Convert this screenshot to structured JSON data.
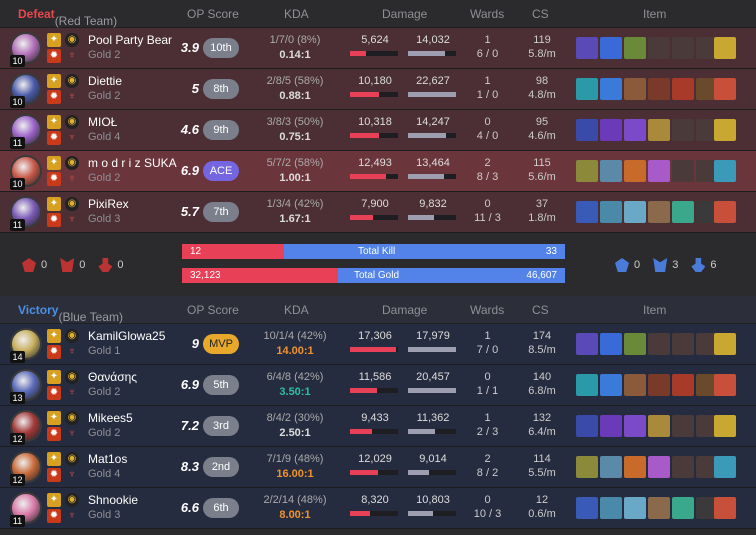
{
  "red": {
    "result": "Defeat",
    "team": "(Red Team)",
    "cols": {
      "op": "OP Score",
      "kda": "KDA",
      "damage": "Damage",
      "wards": "Wards",
      "cs": "CS",
      "item": "Item"
    },
    "players": [
      {
        "name": "Pool Party Bear",
        "tier": "Gold 2",
        "level": "10",
        "score": "3.9",
        "rank": "10th",
        "kda": "1/7/0 (8%)",
        "ratio": "0.14:1",
        "dealt": "5,624",
        "taken": "14,032",
        "dealt_frac": 0.33,
        "taken_frac": 0.78,
        "wards": "1",
        "wards2": "6 / 0",
        "cs": "119",
        "csm": "5.8/m",
        "champ": "#b26fb8",
        "h": false
      },
      {
        "name": "Diettie",
        "tier": "Gold 2",
        "level": "10",
        "score": "5",
        "rank": "8th",
        "kda": "2/8/5 (58%)",
        "ratio": "0.88:1",
        "dealt": "10,180",
        "taken": "22,627",
        "dealt_frac": 0.6,
        "taken_frac": 1.0,
        "wards": "1",
        "wards2": "1 / 0",
        "cs": "98",
        "csm": "4.8/m",
        "champ": "#4a5aa8",
        "h": false
      },
      {
        "name": "MIOŁ",
        "tier": "Gold 4",
        "level": "11",
        "score": "4.6",
        "rank": "9th",
        "kda": "3/8/3 (50%)",
        "ratio": "0.75:1",
        "dealt": "10,318",
        "taken": "14,247",
        "dealt_frac": 0.61,
        "taken_frac": 0.79,
        "wards": "0",
        "wards2": "4 / 0",
        "cs": "95",
        "csm": "4.6/m",
        "champ": "#9c63c8",
        "h": false
      },
      {
        "name": "m o d r i z SUKA",
        "tier": "Gold 2",
        "level": "10",
        "score": "6.9",
        "rank": "ACE",
        "kda": "5/7/2 (58%)",
        "ratio": "1.00:1",
        "dealt": "12,493",
        "taken": "13,464",
        "dealt_frac": 0.74,
        "taken_frac": 0.75,
        "wards": "2",
        "wards2": "8 / 3",
        "cs": "115",
        "csm": "5.6/m",
        "champ": "#c85a4a",
        "h": true
      },
      {
        "name": "PixiRex",
        "tier": "Gold 3",
        "level": "11",
        "score": "5.7",
        "rank": "7th",
        "kda": "1/3/4 (42%)",
        "ratio": "1.67:1",
        "dealt": "7,900",
        "taken": "9,832",
        "dealt_frac": 0.47,
        "taken_frac": 0.55,
        "wards": "0",
        "wards2": "11 / 3",
        "cs": "37",
        "csm": "1.8/m",
        "champ": "#7b5ab5",
        "h": false
      }
    ],
    "objectives": [
      "0",
      "0",
      "0"
    ]
  },
  "totals": {
    "kill_label": "Total Kill",
    "gold_label": "Total Gold",
    "red_kill": "12",
    "blue_kill": "33",
    "red_gold": "32,123",
    "blue_gold": "46,607",
    "kill_frac": 0.267,
    "gold_frac": 0.408
  },
  "blue": {
    "result": "Victory",
    "team": "(Blue Team)",
    "cols": {
      "op": "OP Score",
      "kda": "KDA",
      "damage": "Damage",
      "wards": "Wards",
      "cs": "CS",
      "item": "Item"
    },
    "players": [
      {
        "name": "KamilGlowa25",
        "tier": "Gold 1",
        "level": "14",
        "score": "9",
        "rank": "MVP",
        "kda": "10/1/4 (42%)",
        "ratio": "14.00:1",
        "rc": "gold",
        "dealt": "17,306",
        "taken": "17,979",
        "dealt_frac": 0.96,
        "taken_frac": 1.0,
        "wards": "1",
        "wards2": "7 / 0",
        "cs": "174",
        "csm": "8.5/m",
        "champ": "#c8b060"
      },
      {
        "name": "Θανάσης",
        "tier": "Gold 2",
        "level": "13",
        "score": "6.9",
        "rank": "5th",
        "kda": "6/4/8 (42%)",
        "ratio": "3.50:1",
        "rc": "teal",
        "dealt": "11,586",
        "taken": "20,457",
        "dealt_frac": 0.57,
        "taken_frac": 1.0,
        "wards": "0",
        "wards2": "1 / 1",
        "cs": "140",
        "csm": "6.8/m",
        "champ": "#5a6ab8"
      },
      {
        "name": "Mikees5",
        "tier": "Gold 2",
        "level": "12",
        "score": "7.2",
        "rank": "3rd",
        "kda": "8/4/2 (30%)",
        "ratio": "2.50:1",
        "rc": "",
        "dealt": "9,433",
        "taken": "11,362",
        "dealt_frac": 0.46,
        "taken_frac": 0.56,
        "wards": "1",
        "wards2": "2 / 3",
        "cs": "132",
        "csm": "6.4/m",
        "champ": "#a33a3a"
      },
      {
        "name": "Mat1os",
        "tier": "Gold 4",
        "level": "12",
        "score": "8.3",
        "rank": "2nd",
        "kda": "7/1/9 (48%)",
        "ratio": "16.00:1",
        "rc": "gold",
        "dealt": "12,029",
        "taken": "9,014",
        "dealt_frac": 0.59,
        "taken_frac": 0.44,
        "wards": "2",
        "wards2": "8 / 2",
        "cs": "114",
        "csm": "5.5/m",
        "champ": "#c86a3a"
      },
      {
        "name": "Shnookie",
        "tier": "Gold 3",
        "level": "11",
        "score": "6.6",
        "rank": "6th",
        "kda": "2/2/14 (48%)",
        "ratio": "8.00:1",
        "rc": "gold",
        "dealt": "8,320",
        "taken": "10,803",
        "dealt_frac": 0.41,
        "taken_frac": 0.53,
        "wards": "0",
        "wards2": "10 / 3",
        "cs": "12",
        "csm": "0.6/m",
        "champ": "#d87aa8"
      }
    ],
    "objectives": [
      "0",
      "3",
      "6"
    ]
  }
}
